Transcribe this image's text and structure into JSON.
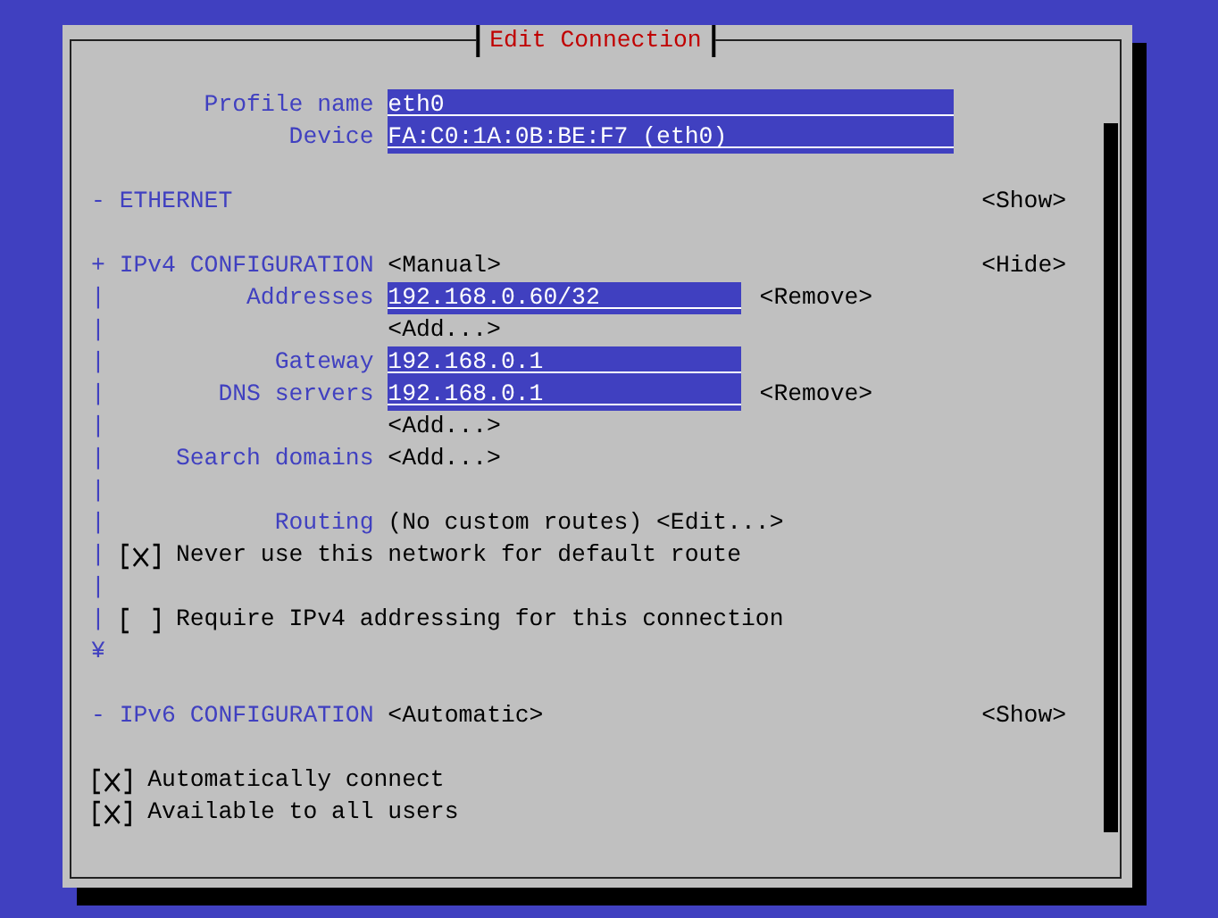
{
  "window": {
    "title": "Edit Connection"
  },
  "profile_fields": [
    {
      "label": "Profile name",
      "value": "eth0"
    },
    {
      "label": "Device",
      "value": "FA:C0:1A:0B:BE:F7 (eth0)"
    }
  ],
  "sections": [
    {
      "marker": "-",
      "title": "ETHERNET",
      "toggle": "<Show>"
    },
    {
      "marker": "+",
      "title": "IPv4 CONFIGURATION",
      "mode": "<Manual>",
      "toggle": "<Hide>",
      "end": "¥",
      "rows": [
        {
          "kind": "field",
          "rail": "|",
          "label": "Addresses",
          "value": "192.168.0.60/32",
          "action": "<Remove>"
        },
        {
          "kind": "button",
          "rail": "|",
          "button": "<Add...>"
        },
        {
          "kind": "field",
          "rail": "|",
          "label": "Gateway",
          "value": "192.168.0.1"
        },
        {
          "kind": "field",
          "rail": "|",
          "label": "DNS servers",
          "value": "192.168.0.1",
          "action": "<Remove>"
        },
        {
          "kind": "button",
          "rail": "|",
          "button": "<Add...>"
        },
        {
          "kind": "button",
          "rail": "|",
          "label": "Search domains",
          "button": "<Add...>"
        },
        {
          "kind": "blank",
          "rail": "|"
        },
        {
          "kind": "info",
          "rail": "|",
          "label": "Routing",
          "text": "(No custom routes)",
          "button": "<Edit...>"
        },
        {
          "kind": "checkbox",
          "rail": "|",
          "label": "Never use this network for default route",
          "checked": true
        },
        {
          "kind": "blank",
          "rail": "|"
        },
        {
          "kind": "checkbox",
          "rail": "|",
          "label": "Require IPv4 addressing for this connection",
          "checked": false
        }
      ]
    },
    {
      "marker": "-",
      "title": "IPv6 CONFIGURATION",
      "mode": "<Automatic>",
      "toggle": "<Show>"
    }
  ],
  "options": [
    {
      "label": "Automatically connect",
      "checked": true
    },
    {
      "label": "Available to all users",
      "checked": true
    }
  ]
}
